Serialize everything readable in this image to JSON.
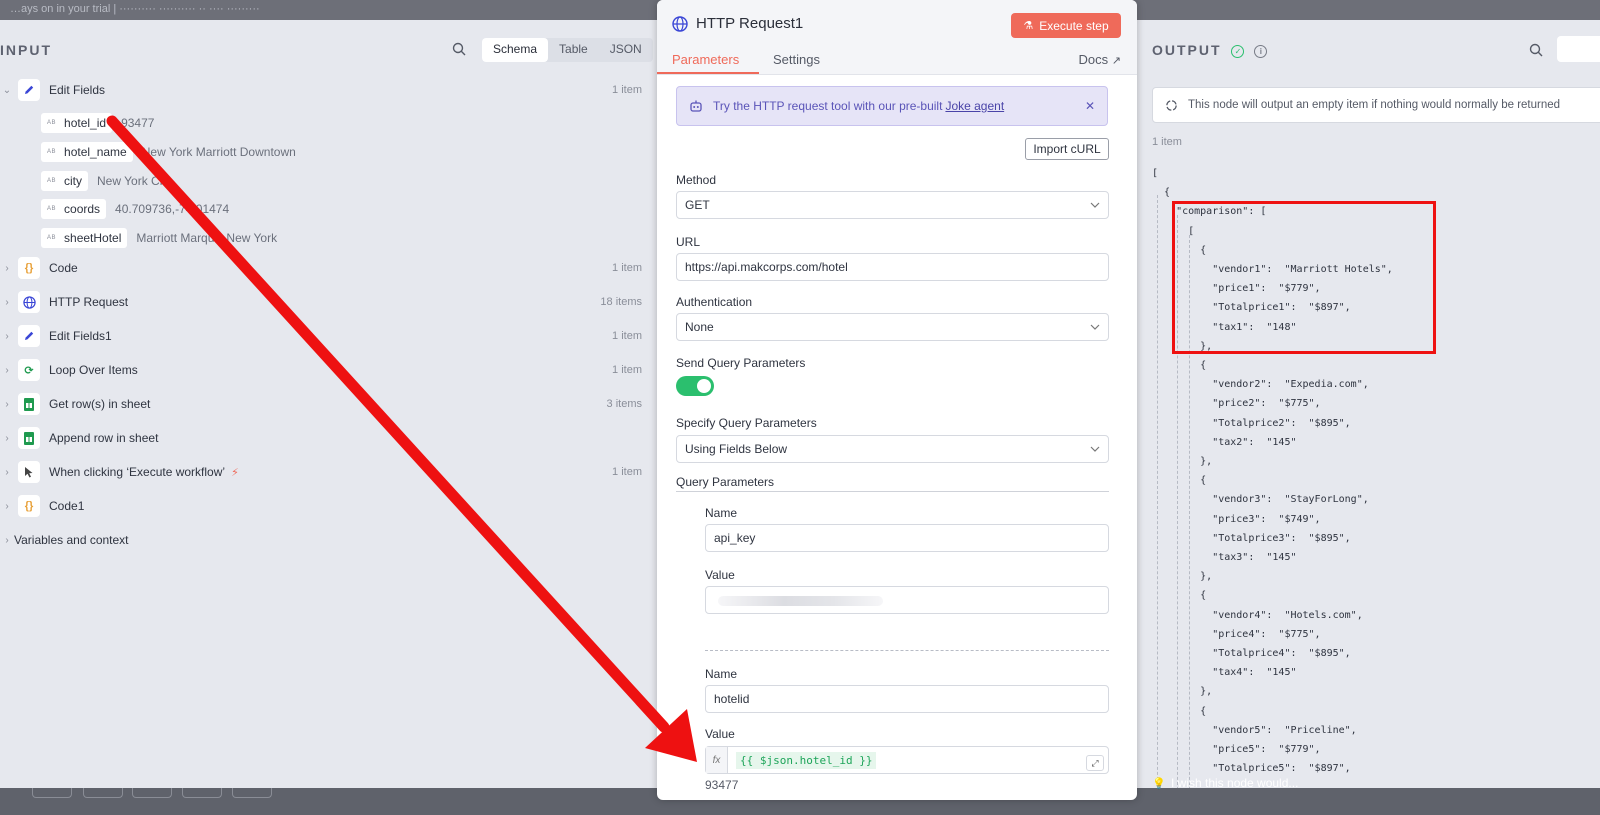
{
  "topbar": {
    "text": "…ays on in your trial  |  ··········  ·········· ·· ···· ·········"
  },
  "input_panel": {
    "title": "INPUT",
    "view_tabs": [
      "Schema",
      "Table",
      "JSON"
    ],
    "active_tab": "Schema",
    "nodes": [
      {
        "name": "Edit Fields",
        "count": "1 item",
        "icon": "pencil-icon",
        "expanded": true
      },
      {
        "name": "Code",
        "count": "1 item",
        "icon": "code-braces-icon"
      },
      {
        "name": "HTTP Request",
        "count": "18 items",
        "icon": "globe-icon"
      },
      {
        "name": "Edit Fields1",
        "count": "1 item",
        "icon": "pencil-icon"
      },
      {
        "name": "Loop Over Items",
        "count": "1 item",
        "icon": "loop-icon"
      },
      {
        "name": "Get row(s) in sheet",
        "count": "3 items",
        "icon": "sheets-icon"
      },
      {
        "name": "Append row in sheet",
        "count": "",
        "icon": "sheets-icon"
      },
      {
        "name": "When clicking ‘Execute workflow’",
        "count": "1 item",
        "icon": "cursor-icon"
      },
      {
        "name": "Code1",
        "count": "",
        "icon": "code-braces-icon"
      }
    ],
    "fields": [
      {
        "key": "hotel_id",
        "value": "93477"
      },
      {
        "key": "hotel_name",
        "value": "New York Marriott Downtown"
      },
      {
        "key": "city",
        "value": "New York City"
      },
      {
        "key": "coords",
        "value": "40.709736,-74.01474"
      },
      {
        "key": "sheetHotel",
        "value": "Marriott Marquis New York"
      }
    ],
    "field_type_badge": "AB",
    "variables": "Variables and context"
  },
  "dialog": {
    "title": "HTTP Request1",
    "execute_label": "Execute step",
    "tabs": [
      "Parameters",
      "Settings"
    ],
    "docs": "Docs",
    "banner": {
      "text": "Try the HTTP request tool with our pre-built",
      "link": "Joke agent"
    },
    "import_curl": "Import cURL",
    "method": {
      "label": "Method",
      "value": "GET"
    },
    "url": {
      "label": "URL",
      "value": "https://api.makcorps.com/hotel"
    },
    "auth": {
      "label": "Authentication",
      "value": "None"
    },
    "send_query": {
      "label": "Send Query Parameters",
      "enabled": true
    },
    "specify_query": {
      "label": "Specify Query Parameters",
      "value": "Using Fields Below"
    },
    "query_params_label": "Query Parameters",
    "param1": {
      "name_label": "Name",
      "name": "api_key",
      "value_label": "Value"
    },
    "param2": {
      "name_label": "Name",
      "name": "hotelid",
      "value_label": "Value",
      "expression": "{{ $json.hotel_id }}",
      "fx": "fx",
      "result": "93477"
    }
  },
  "output_panel": {
    "title": "OUTPUT",
    "notice": "This node will output an empty item if nothing would normally be returned",
    "count": "1 item",
    "json_lines": [
      "[",
      "  {",
      "    \"comparison\": [",
      "      [",
      "        {",
      "          \"vendor1\":  \"Marriott Hotels\",",
      "          \"price1\":  \"$779\",",
      "          \"Totalprice1\":  \"$897\",",
      "          \"tax1\":  \"148\"",
      "        },",
      "        {",
      "          \"vendor2\":  \"Expedia.com\",",
      "          \"price2\":  \"$775\",",
      "          \"Totalprice2\":  \"$895\",",
      "          \"tax2\":  \"145\"",
      "        },",
      "        {",
      "          \"vendor3\":  \"StayForLong\",",
      "          \"price3\":  \"$749\",",
      "          \"Totalprice3\":  \"$895\",",
      "          \"tax3\":  \"145\"",
      "        },",
      "        {",
      "          \"vendor4\":  \"Hotels.com\",",
      "          \"price4\":  \"$775\",",
      "          \"Totalprice4\":  \"$895\",",
      "          \"tax4\":  \"145\"",
      "        },",
      "        {",
      "          \"vendor5\":  \"Priceline\",",
      "          \"price5\":  \"$779\",",
      "          \"Totalprice5\":  \"$897\","
    ],
    "wish": "I wish this node would..."
  },
  "colors": {
    "accent": "#ef6a5a",
    "annotation_red": "#ee1111",
    "toggle_on": "#2bbf6e",
    "expression_green": "#1ea55a"
  }
}
